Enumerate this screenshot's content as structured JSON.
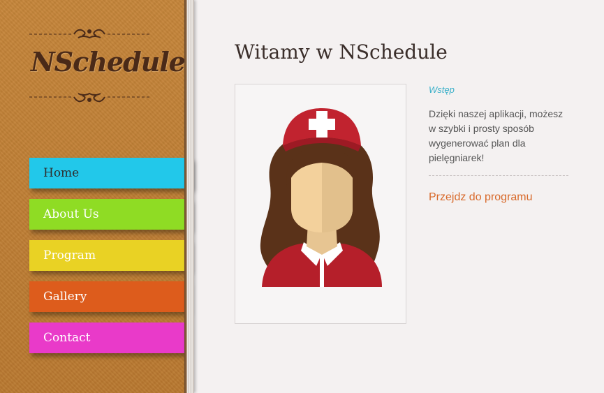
{
  "brand": {
    "logo_text": "NSchedule"
  },
  "nav": {
    "items": [
      {
        "label": "Home",
        "color": "#22c8ea"
      },
      {
        "label": "About Us",
        "color": "#8fdc24"
      },
      {
        "label": "Program",
        "color": "#e9d224"
      },
      {
        "label": "Gallery",
        "color": "#dd5c1c"
      },
      {
        "label": "Contact",
        "color": "#e93ac9"
      }
    ]
  },
  "main": {
    "title": "Witamy w NSchedule",
    "intro_label": "Wstęp",
    "intro_text": "Dzięki naszej aplikacji, możesz w szybki i prosty sposób wygenerować plan dla pielęgniarek!",
    "cta_link": "Przejdz do programu",
    "illustration": "nurse-illustration"
  },
  "colors": {
    "sidebar": "#bf7e36",
    "logo_text": "#4a2a18",
    "accent_intro": "#3bb0c9",
    "accent_link": "#d8692a"
  }
}
